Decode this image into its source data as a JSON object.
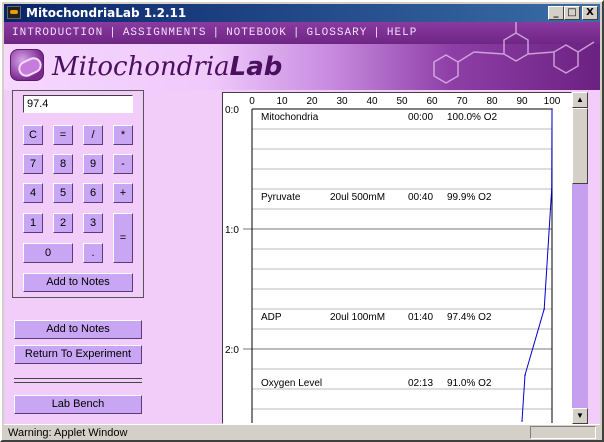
{
  "window": {
    "title": "MitochondriaLab 1.2.11"
  },
  "window_controls": {
    "minimize": "_",
    "maximize": "□",
    "close": "X"
  },
  "menu": [
    "INTRODUCTION",
    "ASSIGNMENTS",
    "NOTEBOOK",
    "GLOSSARY",
    "HELP"
  ],
  "menu_separator": "|",
  "logo": {
    "part1": "Mitochondria",
    "part2": "Lab"
  },
  "calculator": {
    "display": "97.4",
    "keys": [
      [
        "C",
        "=",
        "/",
        "*"
      ],
      [
        "7",
        "8",
        "9",
        "-"
      ],
      [
        "4",
        "5",
        "6",
        "+"
      ],
      [
        "1",
        "2",
        "3",
        "="
      ],
      [
        "0",
        "."
      ]
    ],
    "add_to_notes": "Add to Notes"
  },
  "buttons": {
    "add_to_notes": "Add to Notes",
    "return_to_experiment": "Return To Experiment",
    "lab_bench": "Lab Bench"
  },
  "status": {
    "text": "Warning: Applet Window"
  },
  "chart_data": {
    "type": "line",
    "x_ticks": [
      0,
      10,
      20,
      30,
      40,
      50,
      60,
      70,
      80,
      90,
      100
    ],
    "y_ticks": [
      "0:0",
      "1:0",
      "2:0"
    ],
    "xlim": [
      0,
      100
    ],
    "ylim_minutes": [
      0,
      2.6
    ],
    "grid": "horizontal",
    "series": [
      {
        "values": [
          {
            "time_min": 0.0,
            "o2_percent": 100.0
          },
          {
            "time_min": 0.667,
            "o2_percent": 99.9
          },
          {
            "time_min": 1.667,
            "o2_percent": 97.4
          },
          {
            "time_min": 2.217,
            "o2_percent": 91.0
          },
          {
            "time_min": 2.6,
            "o2_percent": 90.0
          }
        ]
      }
    ],
    "annotations": [
      {
        "label": "Mitochondria",
        "amount": "",
        "time": "00:00",
        "reading": "100.0% O2",
        "time_min": 0.0
      },
      {
        "label": "Pyruvate",
        "amount": "20ul 500mM",
        "time": "00:40",
        "reading": "99.9% O2",
        "time_min": 0.667
      },
      {
        "label": "ADP",
        "amount": "20ul 100mM",
        "time": "01:40",
        "reading": "97.4% O2",
        "time_min": 1.667
      },
      {
        "label": "Oxygen Level",
        "amount": "",
        "time": "02:13",
        "reading": "91.0% O2",
        "time_min": 2.217
      }
    ]
  }
}
